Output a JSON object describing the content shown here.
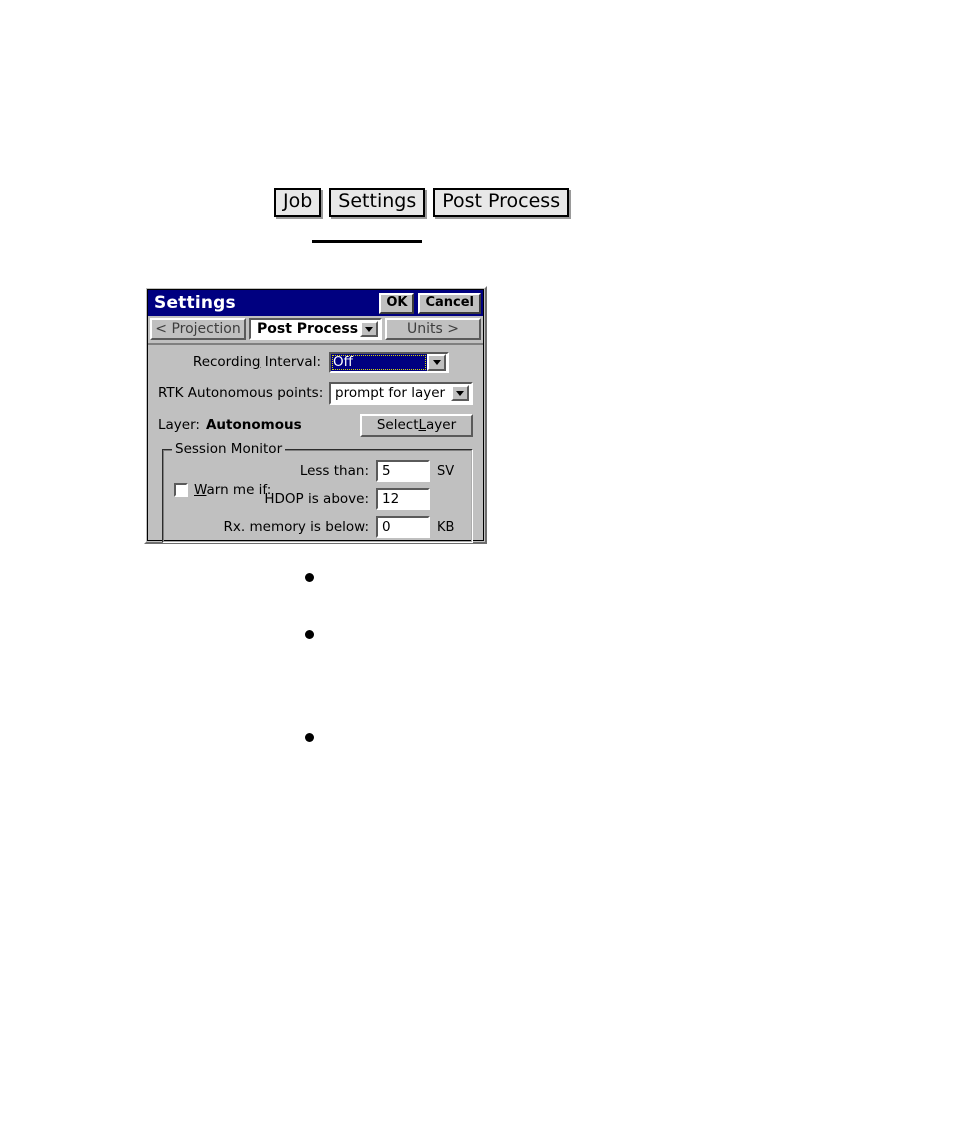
{
  "breadcrumb": {
    "items": [
      {
        "label": "Job"
      },
      {
        "label": "Settings"
      },
      {
        "label": "Post Process"
      }
    ]
  },
  "dialog": {
    "title": "Settings",
    "titlebar_buttons": [
      {
        "label": "OK",
        "name": "ok-button"
      },
      {
        "label": "Cancel",
        "name": "cancel-button"
      }
    ],
    "tabs": {
      "previous": "< Projection",
      "current": "Post Process",
      "next": "Units >",
      "dropdown_icon": "chevron-down-icon"
    },
    "fields": {
      "recording_interval": {
        "label": "Recording Interval:",
        "label_pre": "Recordin",
        "label_accel": "g",
        "label_post": " Interval:",
        "value": "Off",
        "selected": true
      },
      "rtk_autonomous_points": {
        "label": "RTK Autonomous points:",
        "value": "prompt for layer"
      },
      "layer": {
        "caption": "Layer:",
        "value": "Autonomous",
        "button_pre": "Select ",
        "button_accel": "L",
        "button_post": "ayer",
        "button_label": "Select Layer"
      }
    },
    "session_monitor": {
      "legend": "Session Monitor",
      "warn_checkbox": {
        "label": "Warn me if:",
        "label_accel": "W",
        "label_post": "arn me if:",
        "checked": false
      },
      "rows": [
        {
          "label": "Less than:",
          "value": "5",
          "unit": "SV"
        },
        {
          "label": "HDOP is above:",
          "value": "12",
          "unit": ""
        },
        {
          "label": "Rx. memory is below:",
          "value": "0",
          "unit": "KB"
        }
      ]
    }
  },
  "bullets": [
    {
      "name": "bullet-item-1"
    },
    {
      "name": "bullet-item-2"
    },
    {
      "name": "bullet-item-3"
    }
  ],
  "colors": {
    "titlebar": "#000080",
    "dialog_face": "#c0c0c0",
    "selection": "#000080",
    "page_background": "#ffffff"
  }
}
